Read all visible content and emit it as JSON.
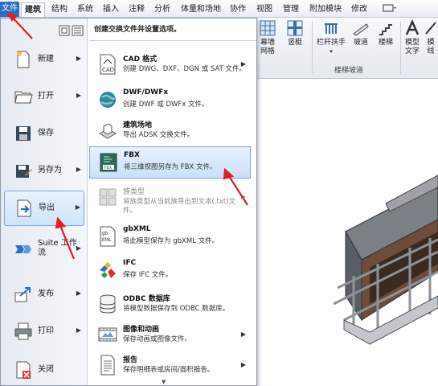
{
  "tabs": [
    "文件",
    "建筑",
    "结构",
    "系统",
    "插入",
    "注释",
    "分析",
    "体量和场地",
    "协作",
    "视图",
    "管理",
    "附加模块",
    "修改"
  ],
  "ribbon": {
    "buttons": [
      {
        "label_line1": "幕墙",
        "label_line2": "网格"
      },
      {
        "label_line1": "竖梃",
        "label_line2": ""
      },
      {
        "label_line1": "栏杆扶手",
        "label_line2": ""
      },
      {
        "label_line1": "坡道",
        "label_line2": ""
      },
      {
        "label_line1": "楼梯",
        "label_line2": ""
      },
      {
        "label_line1": "模型",
        "label_line2": "文字"
      },
      {
        "label_line1": "模",
        "label_line2": "线"
      }
    ],
    "group_label": "楼梯坡道"
  },
  "menu": {
    "header": "创建交换文件并设置选项。",
    "left_items": [
      {
        "label": "新建",
        "has_arrow": true
      },
      {
        "label": "打开",
        "has_arrow": true
      },
      {
        "label": "保存",
        "has_arrow": false
      },
      {
        "label": "另存为",
        "has_arrow": true
      },
      {
        "label": "导出",
        "has_arrow": true
      },
      {
        "label_line1": "Suite 工作",
        "label_line2": "流",
        "has_arrow": true
      },
      {
        "label": "发布",
        "has_arrow": true
      },
      {
        "label": "打印",
        "has_arrow": true
      },
      {
        "label": "关闭",
        "has_arrow": false
      }
    ],
    "right_items": [
      {
        "title": "CAD 格式",
        "desc": "创建 DWG、DXF、DGN 或 SAT 文件。",
        "arrow": true,
        "disabled": false
      },
      {
        "title": "DWF/DWFx",
        "desc": "创建 DWF 或 DWFx 文件。",
        "arrow": false,
        "disabled": false
      },
      {
        "title": "建筑场地",
        "desc": "导出 ADSK 交换文件。",
        "arrow": false,
        "disabled": false
      },
      {
        "title": "FBX",
        "desc": "将三维视图另存为 FBX 文件。",
        "arrow": false,
        "disabled": false,
        "selected": true
      },
      {
        "title": "族类型",
        "desc": "将族类型从当前族导出到文本(.txt)文",
        "desc2": "件。",
        "arrow": true,
        "disabled": true
      },
      {
        "title": "gbXML",
        "desc": "将此模型保存为 gbXML 文件。",
        "arrow": false,
        "disabled": false
      },
      {
        "title": "IFC",
        "desc": "保存 IFC 文件。",
        "arrow": false,
        "disabled": false
      },
      {
        "title": "ODBC 数据库",
        "desc": "将模型数据保存到 ODBC 数据库。",
        "arrow": false,
        "disabled": false
      },
      {
        "title": "图像和动画",
        "desc": "保存动画或图像文件。",
        "arrow": true,
        "disabled": false
      },
      {
        "title": "报告",
        "desc": "保存明细表或房间/面积报告。",
        "arrow": true,
        "disabled": false
      }
    ]
  },
  "colors": {
    "accent": "#2b6fc0",
    "annotation": "#e02020",
    "selection": "#c9e0fa"
  }
}
